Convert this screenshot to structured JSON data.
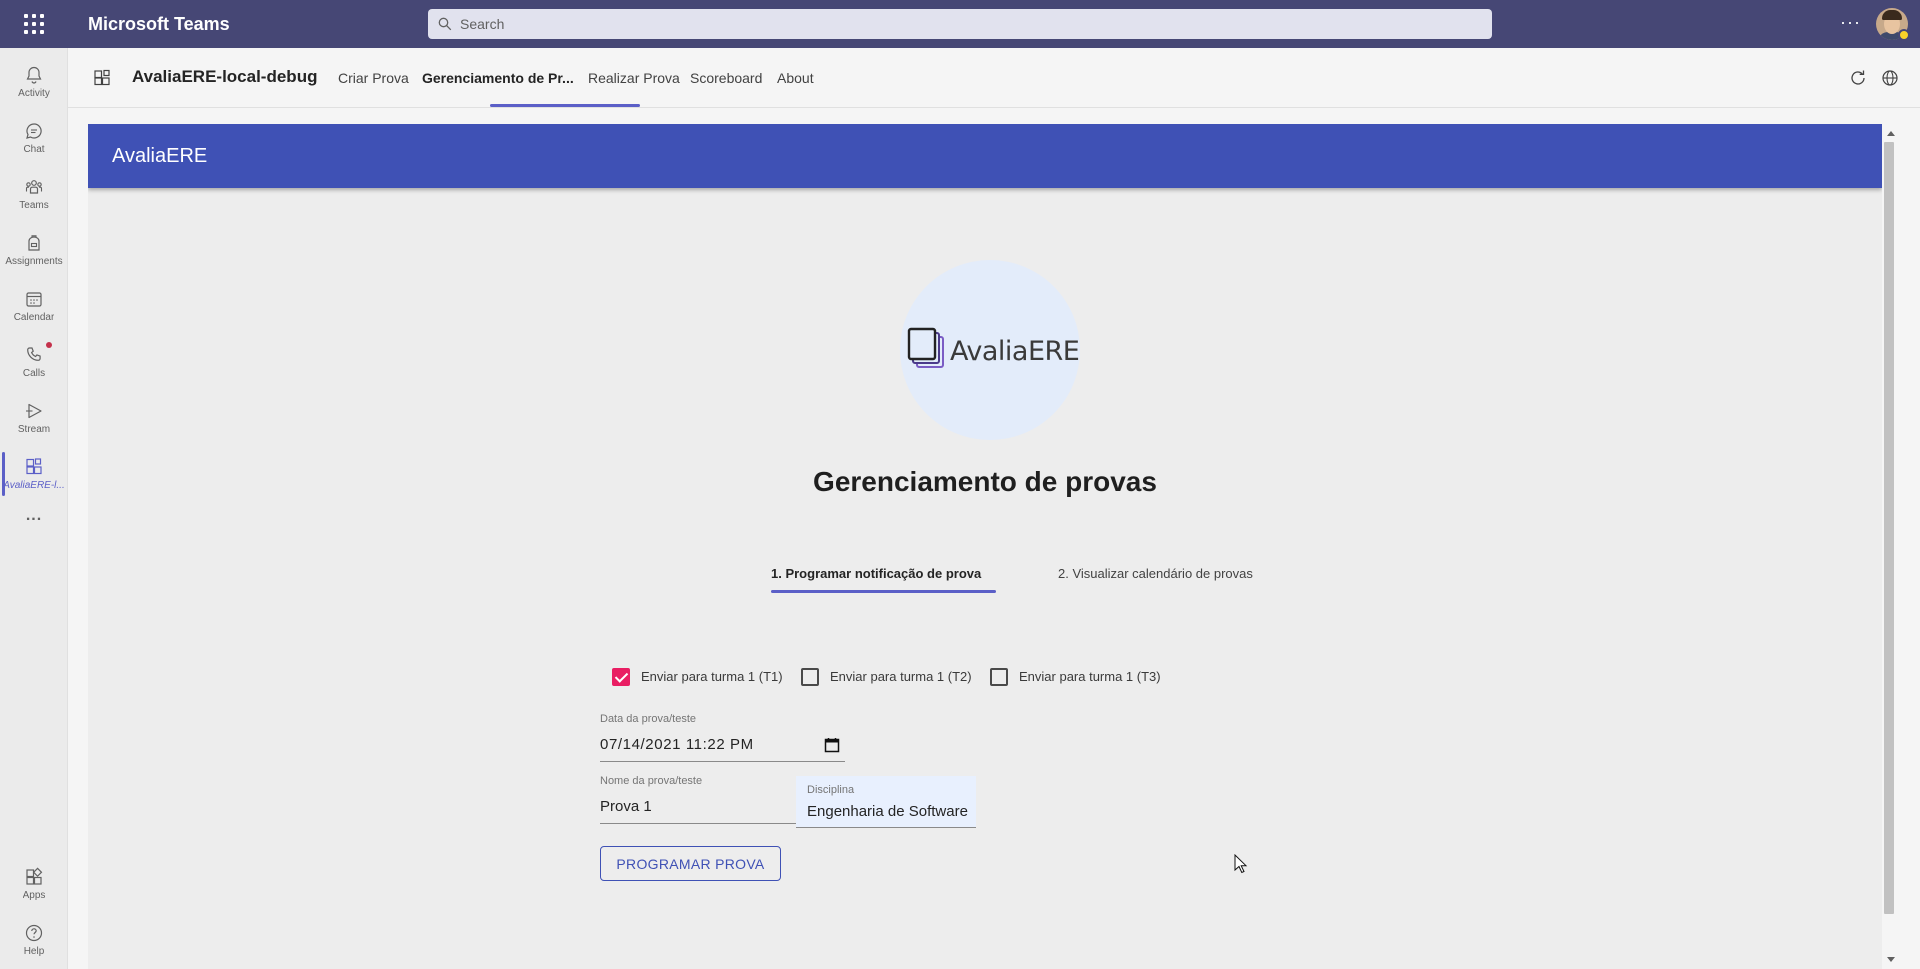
{
  "titlebar": {
    "app_title": "Microsoft Teams",
    "search_placeholder": "Search",
    "more_icon": "more-horizontal-icon",
    "presence_color": "#f8d22a"
  },
  "rail": {
    "items": [
      {
        "label": "Activity",
        "icon": "bell-icon"
      },
      {
        "label": "Chat",
        "icon": "chat-icon"
      },
      {
        "label": "Teams",
        "icon": "teams-icon"
      },
      {
        "label": "Assignments",
        "icon": "backpack-icon"
      },
      {
        "label": "Calendar",
        "icon": "calendar-icon"
      },
      {
        "label": "Calls",
        "icon": "phone-icon"
      },
      {
        "label": "Stream",
        "icon": "play-icon"
      },
      {
        "label": "AvaliaERE-l...",
        "icon": "app-grid-icon"
      }
    ],
    "more": "...",
    "apps_label": "Apps",
    "help_label": "Help",
    "accent": "#5b5fc7",
    "badge_color": "#c4314b"
  },
  "header": {
    "app_name": "AvaliaERE-local-debug",
    "tabs": [
      "Criar Prova",
      "Gerenciamento de Pr...",
      "Realizar Prova",
      "Scoreboard",
      "About"
    ],
    "active_tab": "Gerenciamento de Pr..."
  },
  "app": {
    "banner_title": "AvaliaERE",
    "banner_color": "#3f51b5",
    "logo_text": "AvaliaERE",
    "page_title": "Gerenciamento de provas",
    "steps": [
      "1. Programar notificação de prova",
      "2. Visualizar calendário de provas"
    ],
    "checkboxes": [
      {
        "label": "Enviar para turma 1 (T1)",
        "checked": true
      },
      {
        "label": "Enviar para turma 1 (T2)",
        "checked": false
      },
      {
        "label": "Enviar para turma 1 (T3)",
        "checked": false
      }
    ],
    "date_field": {
      "label": "Data da prova/teste",
      "value": "07/14/2021 11:22 PM"
    },
    "name_field": {
      "label": "Nome da prova/teste",
      "value": "Prova 1"
    },
    "discipline_field": {
      "label": "Disciplina",
      "value": "Engenharia de Software"
    },
    "submit_label": "PROGRAMAR PROVA",
    "checkbox_on_color": "#e91e63"
  }
}
